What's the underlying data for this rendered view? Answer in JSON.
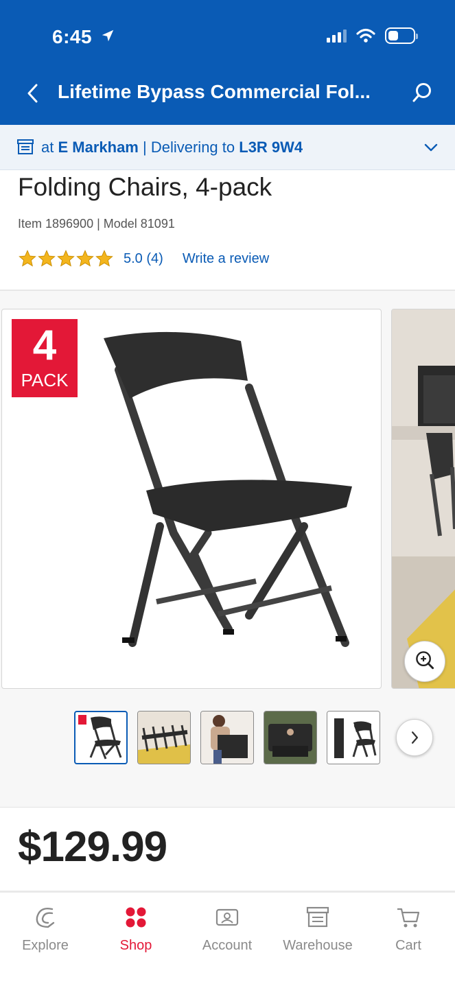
{
  "status_bar": {
    "time": "6:45"
  },
  "header": {
    "title": "Lifetime Bypass Commercial Fol...",
    "colors": {
      "bg": "#0a5bb5",
      "text": "#ffffff"
    }
  },
  "location": {
    "prefix": "at",
    "warehouse": "E Markham",
    "separator": "|",
    "delivering_label": "Delivering to",
    "postal_code": "L3R 9W4"
  },
  "product": {
    "title": "Folding Chairs, 4-pack",
    "item_info": "Item 1896900 | Model 81091",
    "rating": {
      "stars": 5,
      "value": "5.0",
      "count": "(4)"
    },
    "write_review": "Write a review",
    "badge": {
      "number": "4",
      "text": "PACK",
      "color": "#e31837"
    },
    "price": "$129.99"
  },
  "thumbnails": [
    {
      "name": "chair-front"
    },
    {
      "name": "chairs-room"
    },
    {
      "name": "carry-chair"
    },
    {
      "name": "lift-chair"
    },
    {
      "name": "folded-chair"
    }
  ],
  "tabbar": {
    "items": [
      {
        "label": "Explore",
        "icon": "explore-icon"
      },
      {
        "label": "Shop",
        "icon": "shop-icon",
        "active": true
      },
      {
        "label": "Account",
        "icon": "account-icon"
      },
      {
        "label": "Warehouse",
        "icon": "warehouse-icon"
      },
      {
        "label": "Cart",
        "icon": "cart-icon"
      }
    ],
    "active_color": "#e31837"
  }
}
